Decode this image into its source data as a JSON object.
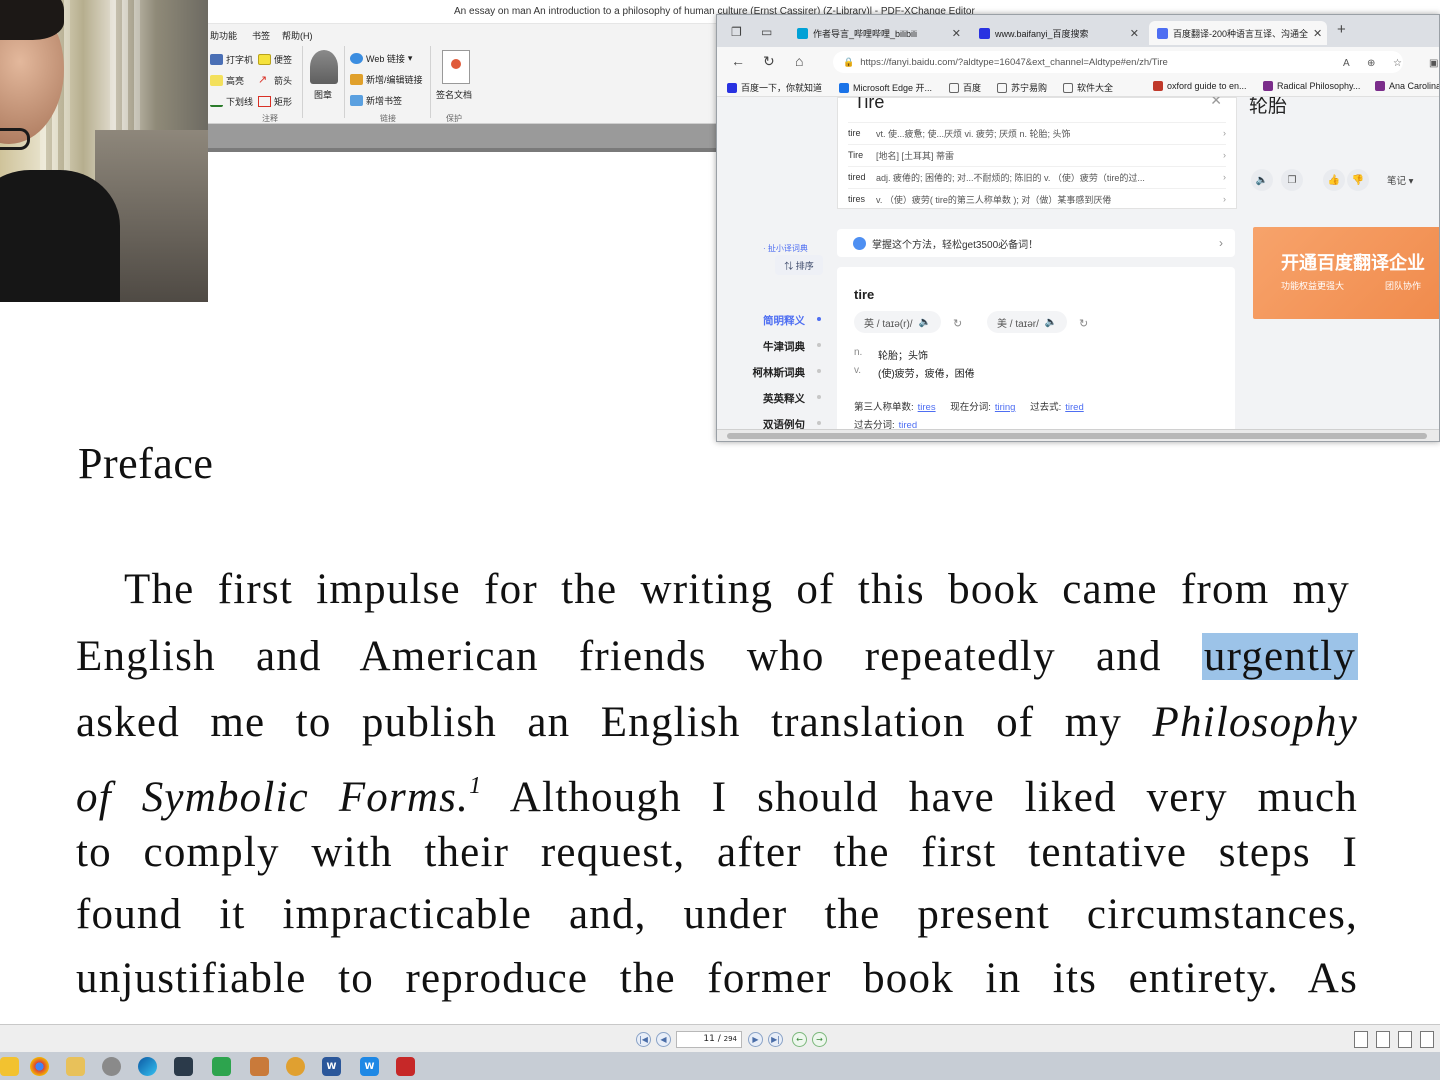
{
  "app": {
    "title": "An essay on man An introduction to a philosophy of human culture (Ernst Cassirer) (Z-Library)l - PDF-XChange Editor",
    "menu_tabs": [
      "助功能",
      "书签",
      "帮助(H)"
    ],
    "ribbon": {
      "items": [
        "打字机",
        "便签",
        "高亮",
        "箭头",
        "下划线",
        "矩形",
        "图章",
        "Web 链接",
        "新增/编辑链接",
        "新增书签",
        "签名文档"
      ],
      "groups": [
        "注释",
        "链接",
        "保护"
      ]
    }
  },
  "document": {
    "heading": "Preface",
    "lines": [
      "The  first impulse  for the writing of this book came from my",
      "English  and American  friends who repeatedly and ",
      "asked me to publish  an English  translation of my ",
      " Although I should have liked  very much",
      "to comply  with their  request, after the  first tentative steps I",
      "found it impracticable and, under the  present circumstances,",
      "unjustifiable  to reproduce the former book in its entirety. As"
    ],
    "selected_word": "urgently",
    "italic_title_part1": "Philosophy",
    "italic_title_part2": "of Symbolic Forms.",
    "footnote_mark": "1"
  },
  "browser": {
    "tabs": [
      {
        "label": "作者导言_哔哩哔哩_bilibili",
        "favicon_color": "#00a1d6"
      },
      {
        "label": "www.baifanyi_百度搜索",
        "favicon_color": "#2932e1"
      },
      {
        "label": "百度翻译-200种语言互译、沟通全",
        "favicon_color": "#4e6ef2"
      }
    ],
    "new_tab": "+",
    "url": "https://fanyi.baidu.com/?aldtype=16047&ext_channel=Aldtype#en/zh/Tire",
    "bookmarks": [
      "百度一下，你就知道",
      "Microsoft Edge 开...",
      "百度",
      "苏宁易购",
      "软件大全",
      "oxford guide to en...",
      "Radical Philosophy...",
      "Ana Carolina"
    ],
    "suggest": {
      "query": "Tire",
      "rows": [
        {
          "word": "tire",
          "def": "vt. 使...疲惫; 使...厌烦 vi. 疲劳; 厌烦 n. 轮胎; 头饰"
        },
        {
          "word": "Tire",
          "def": "[地名] [土耳其] 蒂雷"
        },
        {
          "word": "tired",
          "def": "adj. 疲倦的; 困倦的; 对...不耐烦的; 陈旧的 v. （使）疲劳（tire的过..."
        },
        {
          "word": "tires",
          "def": "v. （使）疲劳( tire的第三人称单数 ); 对（做）某事感到厌倦"
        }
      ]
    },
    "sidebar": {
      "small_dict_link": " ·  扯小译词典",
      "sort_label": "⇅ 排序",
      "nav": [
        "简明释义",
        "牛津词典",
        "柯林斯词典",
        "英英释义",
        "双语例句"
      ]
    },
    "banner": "掌握这个方法，轻松get3500必备词！",
    "dict": {
      "word": "tire",
      "uk_pron": "英 / taɪə(r)/",
      "us_pron": "美 / taɪər/",
      "defs": [
        {
          "pos": "n.",
          "text": "轮胎；头饰"
        },
        {
          "pos": "v.",
          "text": "(使)疲劳，疲倦，困倦"
        }
      ],
      "forms_labels": [
        "第三人称单数:",
        "现在分词:",
        "过去式:"
      ],
      "forms_values": [
        "tires",
        "tiring",
        "tired"
      ],
      "past_participle_label": "过去分词:",
      "past_participle_value": "tired"
    },
    "result": {
      "translation": "轮胎",
      "notes_label": "笔记 ▾"
    },
    "promo": {
      "title": "开通百度翻译企业",
      "sub1": "功能权益更强大",
      "sub2": "团队协作"
    }
  },
  "pdf_nav": {
    "page_value": "11",
    "page_total": "294"
  },
  "taskbar": {
    "icons": [
      "file-explorer-icon",
      "chrome-icon",
      "app-icon",
      "app-icon",
      "edge-icon",
      "camera-app-icon",
      "app-icon",
      "app-icon",
      "search-app-icon",
      "word-icon",
      "writer-icon",
      "pdf-xchange-icon"
    ]
  },
  "colors": {
    "selection": "#9cc3e8",
    "link": "#4e6ef2",
    "promo": "#f08a4b"
  }
}
